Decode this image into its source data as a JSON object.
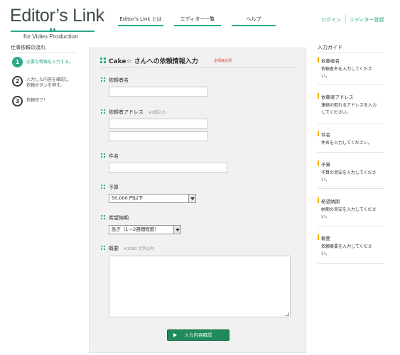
{
  "logo": {
    "main": "Editor’s Link",
    "sub": "for Video Production"
  },
  "nav": {
    "items": [
      "Editor’s Link とは",
      "エディター一覧",
      "ヘルプ"
    ],
    "login": "ログイン",
    "register": "エディター登録"
  },
  "flow": {
    "title": "仕事依頼の流れ",
    "steps": [
      {
        "num": "1",
        "label": "必要な情報を入力する。"
      },
      {
        "num": "2",
        "label": "入力した内容を確認し依頼ボタンを押す。",
        "line1": "入力した内容を確認し",
        "line2": "依頼ボタンを押す。"
      },
      {
        "num": "3",
        "label": "依頼完了！"
      }
    ]
  },
  "form": {
    "title": "Cake☆ さんへの依頼情報入力",
    "required_note": "全項目必須",
    "fields": {
      "name": {
        "label": "依頼者名",
        "value": ""
      },
      "email": {
        "label": "依頼者アドレス",
        "note": "※2回入力",
        "value": "",
        "confirm_value": ""
      },
      "subject": {
        "label": "件名",
        "value": ""
      },
      "budget": {
        "label": "予算",
        "selected": "50,000 円以下"
      },
      "deadline": {
        "label": "希望納期",
        "selected": "急ぎ（1〜2週間程度）"
      },
      "summary": {
        "label": "概要",
        "note": "※1000 文字以内",
        "value": ""
      }
    },
    "submit_label": "入力内容確認"
  },
  "guide": {
    "title": "入力ガイド",
    "items": [
      {
        "head": "依頼者名",
        "line1": "依頼者名を入力してくださ",
        "line2": "い。"
      },
      {
        "head": "依頼者アドレス",
        "line1": "連絡の取れるアドレスを入力",
        "line2": "してください。"
      },
      {
        "head": "件名",
        "line1": "件名を入力してください。",
        "line2": ""
      },
      {
        "head": "予算",
        "line1": "予算の目安を入力してくださ",
        "line2": "い。"
      },
      {
        "head": "希望納期",
        "line1": "納期の目安を入力してくださ",
        "line2": "い。"
      },
      {
        "head": "概要",
        "line1": "依頼概要を入力してくださ",
        "line2": "い。"
      }
    ]
  },
  "colors": {
    "accent": "#2aa98b",
    "button": "#1f8a5a",
    "required": "#e03030",
    "guide_bar": "#f0b400"
  }
}
